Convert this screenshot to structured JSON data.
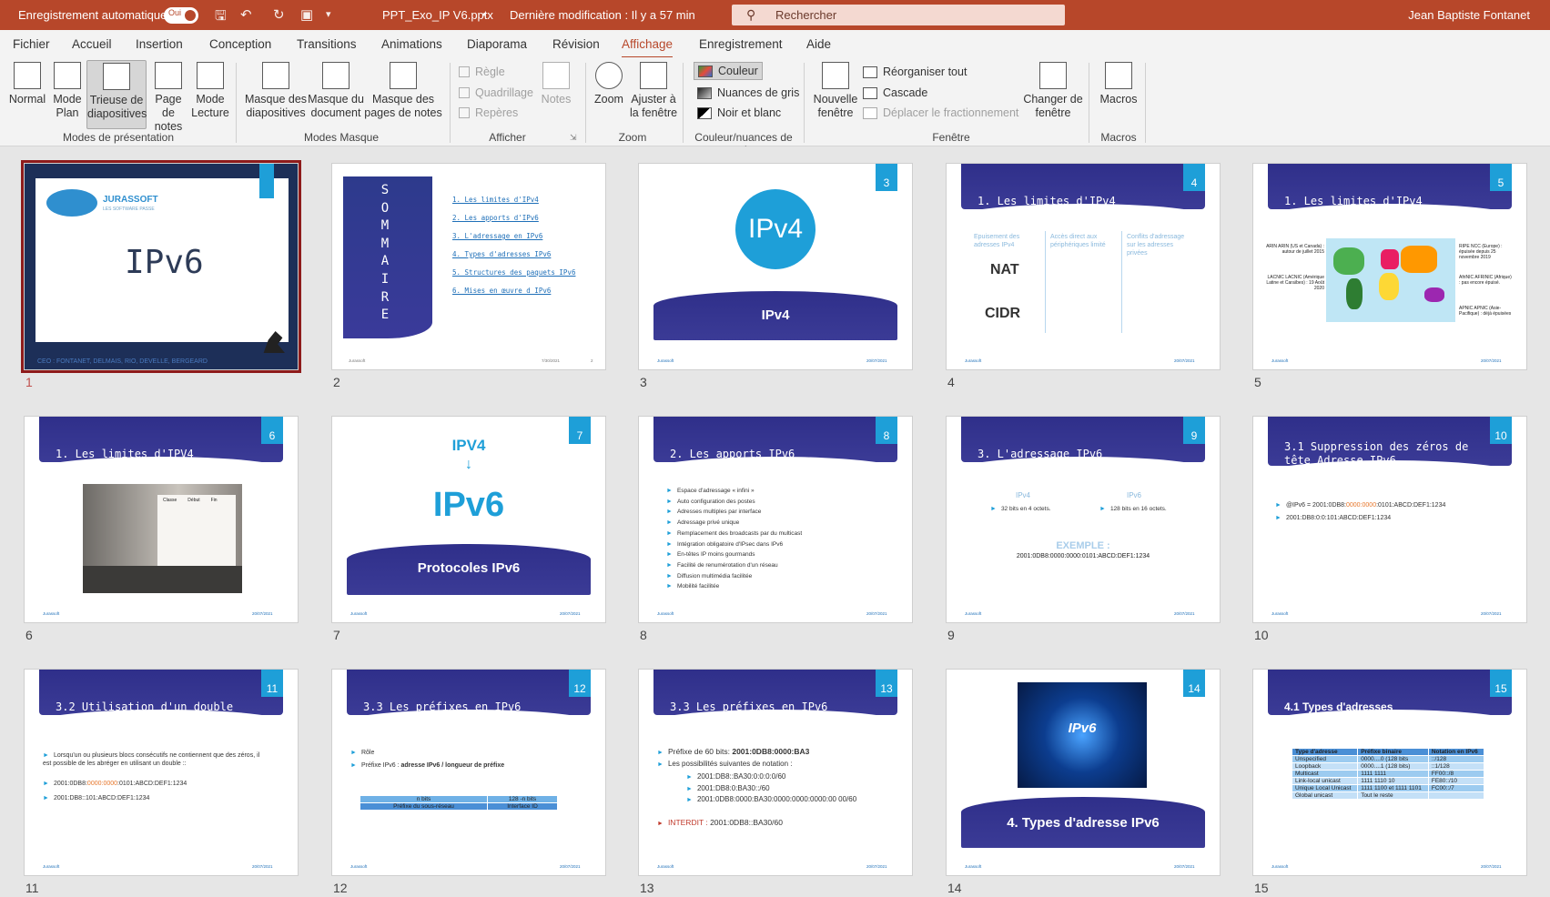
{
  "titlebar": {
    "autosave": "Enregistrement automatique",
    "autosave_state": "Oui",
    "filename": "PPT_Exo_IP V6.pptx",
    "modified": "Dernière modification : Il y a 57 min",
    "search_placeholder": "Rechercher",
    "user": "Jean Baptiste Fontanet"
  },
  "menu": [
    "Fichier",
    "Accueil",
    "Insertion",
    "Conception",
    "Transitions",
    "Animations",
    "Diaporama",
    "Révision",
    "Affichage",
    "Enregistrement",
    "Aide"
  ],
  "ribbon": {
    "views": {
      "normal": "Normal",
      "plan": "Mode Plan",
      "trieuse": "Trieuse de diapositives",
      "notes": "Page de notes",
      "lecture": "Mode Lecture",
      "group": "Modes de présentation"
    },
    "masters": {
      "slide_master": "Masque des diapositives",
      "doc_master": "Masque du document",
      "notes_master": "Masque des pages de notes",
      "group": "Modes Masque"
    },
    "show": {
      "regle": "Règle",
      "quadrillage": "Quadrillage",
      "reperes": "Repères",
      "notes": "Notes",
      "group": "Afficher"
    },
    "zoom": {
      "zoom": "Zoom",
      "fit": "Ajuster à la fenêtre",
      "group": "Zoom"
    },
    "color": {
      "color": "Couleur",
      "gray": "Nuances de gris",
      "bw": "Noir et blanc",
      "group": "Couleur/nuances de gris"
    },
    "window": {
      "new": "Nouvelle fenêtre",
      "arrange": "Réorganiser tout",
      "cascade": "Cascade",
      "move_split": "Déplacer le fractionnement",
      "switch": "Changer de fenêtre",
      "group": "Fenêtre"
    },
    "macros": {
      "macros": "Macros",
      "group": "Macros"
    }
  },
  "slides": {
    "s1": {
      "num": "1",
      "brand": "JURASSOFT",
      "tagline": "LES SOFTWARE PASSE",
      "title": "IPv6",
      "footer": "CEO : FONTANET, DELMAIS, RIO, DEVELLE, BERGEARD"
    },
    "s2": {
      "num": "2",
      "letters": [
        "S",
        "O",
        "M",
        "M",
        "A",
        "I",
        "R",
        "E"
      ],
      "items": [
        "1. Les limites d'IPv4",
        "2. Les apports d'IPv6",
        "3. L'adressage en IPv6",
        "4. Types d'adresses IPv6",
        "5. Structures des paquets IPv6",
        "6. Mises en œuvre d IPv6"
      ],
      "footer_l": "Jurassoft",
      "footer_d": "7/30/2021",
      "footer_n": "2"
    },
    "s3": {
      "num": "3",
      "tag": "3",
      "circle": "IPv4",
      "title": "IPv4",
      "footer_l": "Jurassoft",
      "footer_d": "20/07/2021"
    },
    "s4": {
      "num": "4",
      "tag": "4",
      "title": "1. Les limites d'IPv4",
      "cols": [
        "Epuisement des adresses IPv4",
        "Accès direct aux périphériques limité",
        "Conflits d'adressage sur les adresses privées"
      ],
      "nat": "NAT",
      "cidr": "CIDR",
      "footer_l": "Jurassoft",
      "footer_d": "20/07/2021"
    },
    "s5": {
      "num": "5",
      "tag": "5",
      "title": "1. Les limites d'IPv4",
      "l1": "ARIN ARIN (US et Canada) : autour de juillet 2015",
      "l2": "LACNIC LACNIC (Amérique Latine et Caraïbes) : 19 Août 2020",
      "r1": "RIPE NCC (Europe) : épuisée depuis 25 novembre 2019",
      "r2": "AfriNIC AFRINIC (Afrique) : pas encore épuisé.",
      "r3": "APNIC APNIC (Asie-Pacifique) : déjà épuisées",
      "footer_l": "Jurassoft",
      "footer_d": "20/07/2021"
    },
    "s6": {
      "num": "6",
      "tag": "6",
      "title": "1. Les limites d'IPV4",
      "table_head": [
        "Classe",
        "Début",
        "Fin"
      ],
      "footer_l": "Jurassoft",
      "footer_d": "20/07/2021"
    },
    "s7": {
      "num": "7",
      "tag": "7",
      "top": "IPV4",
      "big": "IPv6",
      "title": "Protocoles IPv6",
      "footer_l": "Jurassoft",
      "footer_d": "20/07/2021"
    },
    "s8": {
      "num": "8",
      "tag": "8",
      "title": "2. Les apports IPv6",
      "items": [
        "Espace d'adressage « infini »",
        "Auto configuration des postes",
        "Adresses multiples par interface",
        "Adressage privé unique",
        "Remplacement des broadcasts par du multicast",
        "Intégration obligatoire d'IPsec dans IPv6",
        "En-têtes IP moins gourmands",
        "Facilité de renumérotation d'un réseau",
        "Diffusion multimédia facilitée",
        "Mobilité facilitée"
      ],
      "footer_l": "Jurassoft",
      "footer_d": "20/07/2021"
    },
    "s9": {
      "num": "9",
      "tag": "9",
      "title": "3. L'adressage IPv6",
      "c1": "IPv4",
      "c2": "IPv6",
      "b1": "32 bits en 4 octets.",
      "b2": "128 bits en 16 octets.",
      "ex": "EXEMPLE :",
      "addr": "2001:0DB8:0000:0000:0101:ABCD:DEF1:1234",
      "footer_l": "Jurassoft",
      "footer_d": "20/07/2021"
    },
    "s10": {
      "num": "10",
      "tag": "10",
      "title": "3.1 Suppression des zéros de tête Adresse IPv6",
      "l1a": "@IPv6 = 2001:0DB8:",
      "l1b": "0000:0000",
      "l1c": ":0101:ABCD:DEF1:1234",
      "l2": "2001:DB8:0:0:101:ABCD:DEF1:1234",
      "footer_l": "Jurassoft",
      "footer_d": "20/07/2021"
    },
    "s11": {
      "num": "11",
      "tag": "11",
      "title": "3.2 Utilisation d'un double",
      "p": "Lorsqu'un ou plusieurs blocs consécutifs ne contiennent que des zéros, il est possible de les abréger en utilisant un double ::",
      "l1a": "2001:0DB8:",
      "l1b": "0000:0000",
      "l1c": ":0101:ABCD:DEF1:1234",
      "l2": "2001:DB8::101:ABCD:DEF1:1234",
      "footer_l": "Jurassoft",
      "footer_d": "20/07/2021"
    },
    "s12": {
      "num": "12",
      "tag": "12",
      "title": "3.3 Les préfixes en IPv6",
      "b1": "Rôle",
      "b2a": "Préfixe IPv6 : ",
      "b2b": "adresse IPv6 / longueur de préfixe",
      "t": [
        [
          "n bits",
          "128 -n bits"
        ],
        [
          "Préfixe du sous-réseau",
          "Interface ID"
        ]
      ],
      "footer_l": "Jurassoft",
      "footer_d": "20/07/2021"
    },
    "s13": {
      "num": "13",
      "tag": "13",
      "title": "3.3 Les préfixes en IPv6",
      "b1a": "Préfixe de 60 bits: ",
      "b1b": "2001:0DB8:0000:BA3",
      "b2": "Les possibilités suivantes de notation :",
      "sub": [
        "2001:DB8::BA30:0:0:0:0/60",
        "2001:DB8:0:BA30::/60",
        "2001:0DB8:0000:BA30:0000:0000:0000:00 00/60"
      ],
      "b3a": "INTERDIT : ",
      "b3b": " 2001:0DB8::BA30/60",
      "footer_l": "Jurassoft",
      "footer_d": "20/07/2021"
    },
    "s14": {
      "num": "14",
      "tag": "14",
      "img": "IPv6",
      "title": "4. Types d'adresse IPv6",
      "footer_l": "Jurassoft",
      "footer_d": "20/07/2021"
    },
    "s15": {
      "num": "15",
      "tag": "15",
      "title": "4.1 Types d'adresses",
      "t": [
        [
          "Type d'adresse",
          "Préfixe binaire",
          "Notation en IPv6"
        ],
        [
          "Unspecified",
          "0000....0 (128 bits",
          "::/128"
        ],
        [
          "Loopback",
          "0000....1 (128 bits)",
          "::1/128"
        ],
        [
          "Multicast",
          "1111 1111",
          "FF00::/8"
        ],
        [
          "Link-local unicast",
          "1111 1110 10",
          "FE80::/10"
        ],
        [
          "Unique Local Unicast",
          "1111 1100 et 1111 1101",
          "FC00::/7"
        ],
        [
          "Global unicast",
          "Tout le reste",
          ""
        ]
      ],
      "footer_l": "Jurassoft",
      "footer_d": "20/07/2021"
    }
  },
  "colors": {
    "accent": "#b7472a",
    "band": "#2f2f8a",
    "tag": "#1e9fd8",
    "selected_outline": "#8e1b1b"
  }
}
